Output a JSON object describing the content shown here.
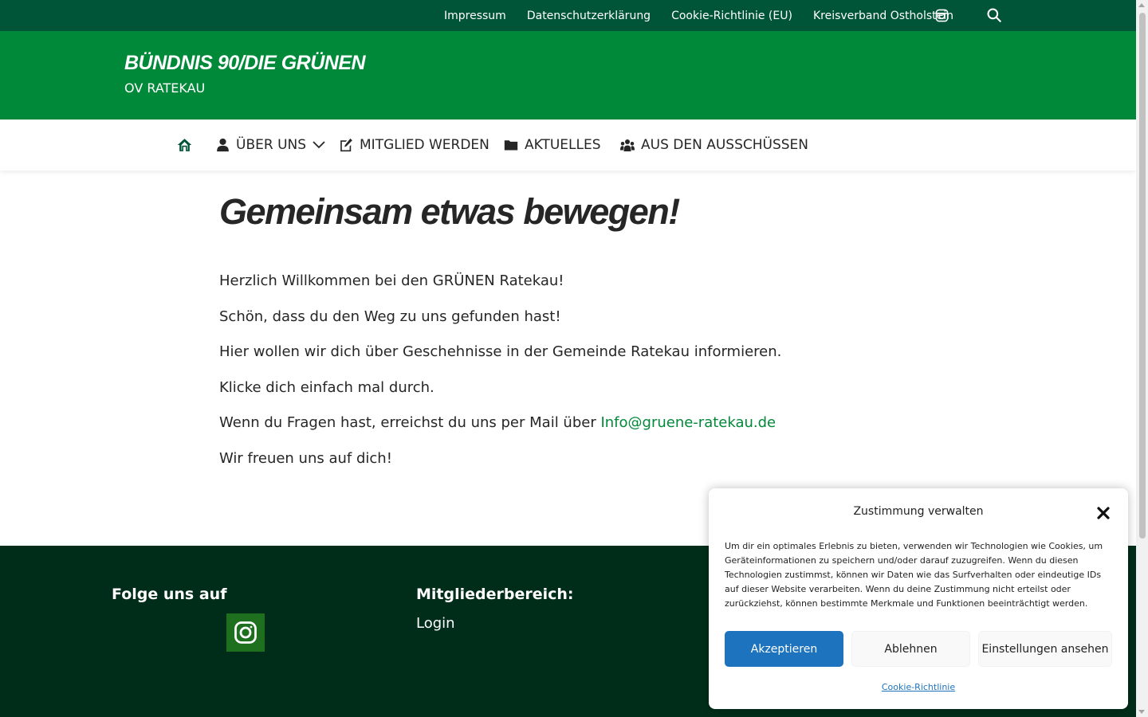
{
  "topbar": {
    "links": [
      {
        "label": "Impressum"
      },
      {
        "label": "Datenschutzerklärung"
      },
      {
        "label": "Cookie-Richtlinie (EU)"
      },
      {
        "label": "Kreisverband Ostholstein"
      }
    ],
    "icons": [
      "instagram-icon",
      "search-icon"
    ]
  },
  "brand": {
    "title": "BÜNDNIS 90/DIE GRÜNEN",
    "subtitle": "OV RATEKAU"
  },
  "nav": {
    "items": [
      {
        "label": "",
        "icon": "home-icon"
      },
      {
        "label": "ÜBER UNS",
        "icon": "person-icon",
        "has_dropdown": true
      },
      {
        "label": "MITGLIED WERDEN",
        "icon": "edit-icon"
      },
      {
        "label": "AKTUELLES",
        "icon": "folder-icon"
      },
      {
        "label": "AUS DEN AUSSCHÜSSEN",
        "icon": "group-icon"
      }
    ]
  },
  "content": {
    "title": "Gemeinsam etwas bewegen!",
    "paragraphs": [
      "Herzlich Willkommen bei den GRÜNEN Ratekau!",
      "Schön, dass du den Weg zu uns gefunden hast!",
      "Hier wollen wir dich über Geschehnisse in der Gemeinde Ratekau informieren.",
      "Klicke dich einfach mal durch.",
      "Wenn du Fragen hast, erreichst du uns per Mail über ",
      "Wir freuen uns auf dich!"
    ],
    "email_link": "Info@gruene-ratekau.de"
  },
  "footer": {
    "follow_heading": "Folge uns auf",
    "members_heading": "Mitgliederbereich:",
    "login_label": "Login"
  },
  "cookie": {
    "title": "Zustimmung verwalten",
    "text": "Um dir ein optimales Erlebnis zu bieten, verwenden wir Technologien wie Cookies, um Geräteinformationen zu speichern und/oder darauf zuzugreifen. Wenn du diesen Technologien zustimmst, können wir Daten wie das Surfverhalten oder eindeutige IDs auf dieser Website verarbeiten. Wenn du deine Zustimmung nicht erteilst oder zurückziehst, können bestimmte Merkmale und Funktionen beeinträchtigt werden.",
    "accept_label": "Akzeptieren",
    "deny_label": "Ablehnen",
    "prefs_label": "Einstellungen ansehen",
    "policy_label": "Cookie-Richtlinie"
  },
  "colors": {
    "topbar": "#005437",
    "brand": "#008939",
    "footer": "#002d1a",
    "link": "#008939",
    "accept": "#1e73be"
  }
}
